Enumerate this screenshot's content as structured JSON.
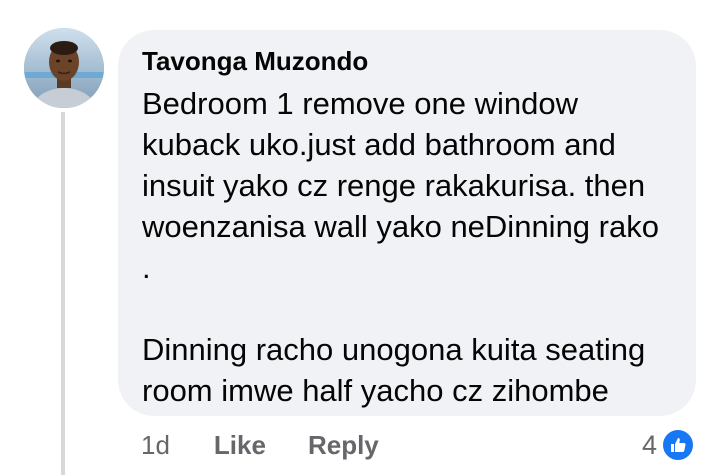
{
  "comment": {
    "author": "Tavonga Muzondo",
    "paragraphs": [
      "Bedroom 1 remove one window kuback uko.just add bathroom and insuit yako cz renge rakakurisa. then woenzanisa wall yako neDinning rako .",
      "Dinning racho unogona kuita seating room imwe half yacho cz zihombe"
    ],
    "time": "1d",
    "like_label": "Like",
    "reply_label": "Reply",
    "reaction_count": "4",
    "reaction_icon": "like-thumb-icon"
  },
  "colors": {
    "bubble": "#f0f2f5",
    "like_blue": "#1877f2",
    "meta_gray": "#65676b",
    "thread_line": "#d6d8dc"
  }
}
